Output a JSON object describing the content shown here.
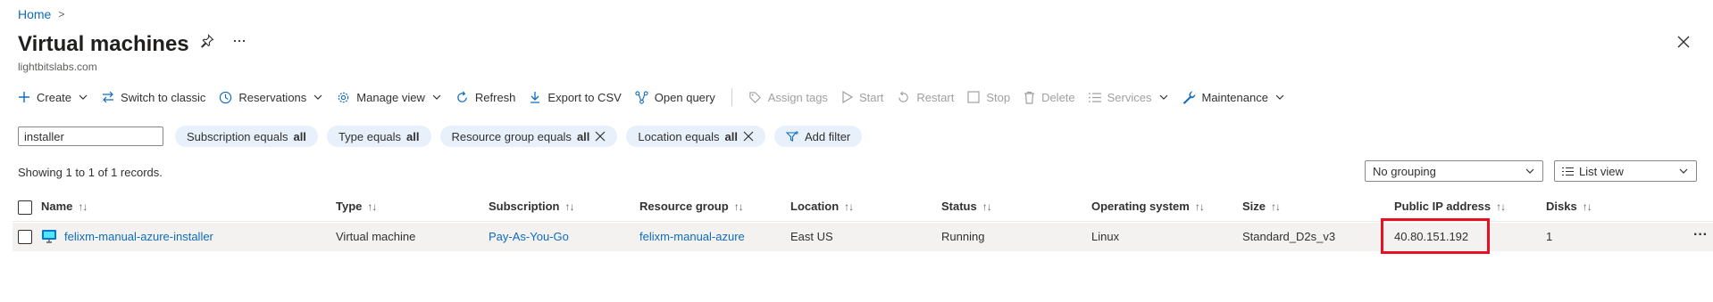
{
  "breadcrumb": {
    "home": "Home",
    "chevron": ">"
  },
  "page": {
    "title": "Virtual machines",
    "tenant": "lightbitslabs.com"
  },
  "icons": {
    "pin": "pin-icon",
    "more": "ellipsis-icon",
    "close": "close-icon"
  },
  "toolbar": {
    "create": "Create",
    "switch_classic": "Switch to classic",
    "reservations": "Reservations",
    "manage_view": "Manage view",
    "refresh": "Refresh",
    "export_csv": "Export to CSV",
    "open_query": "Open query",
    "assign_tags": "Assign tags",
    "start": "Start",
    "restart": "Restart",
    "stop": "Stop",
    "delete": "Delete",
    "services": "Services",
    "maintenance": "Maintenance"
  },
  "filters": {
    "search_value": "installer",
    "pills": [
      {
        "label": "Subscription equals",
        "value": "all"
      },
      {
        "label": "Type equals",
        "value": "all"
      },
      {
        "label": "Resource group equals",
        "value": "all"
      },
      {
        "label": "Location equals",
        "value": "all"
      }
    ],
    "add_filter": "Add filter"
  },
  "records_text": "Showing 1 to 1 of 1 records.",
  "grouping": {
    "selected": "No grouping"
  },
  "view": {
    "selected": "List view"
  },
  "table": {
    "columns": [
      "Name",
      "Type",
      "Subscription",
      "Resource group",
      "Location",
      "Status",
      "Operating system",
      "Size",
      "Public IP address",
      "Disks"
    ],
    "rows": [
      {
        "name": "felixm-manual-azure-installer",
        "type": "Virtual machine",
        "subscription": "Pay-As-You-Go",
        "resource_group": "felixm-manual-azure",
        "location": "East US",
        "status": "Running",
        "os": "Linux",
        "size": "Standard_D2s_v3",
        "public_ip": "40.80.151.192",
        "disks": "1",
        "more": "···"
      }
    ]
  },
  "colors": {
    "accent": "#0f6cbd",
    "pill_bg": "#e8f1fb",
    "row_bg": "#f3f2f1",
    "highlight": "#e81123"
  }
}
